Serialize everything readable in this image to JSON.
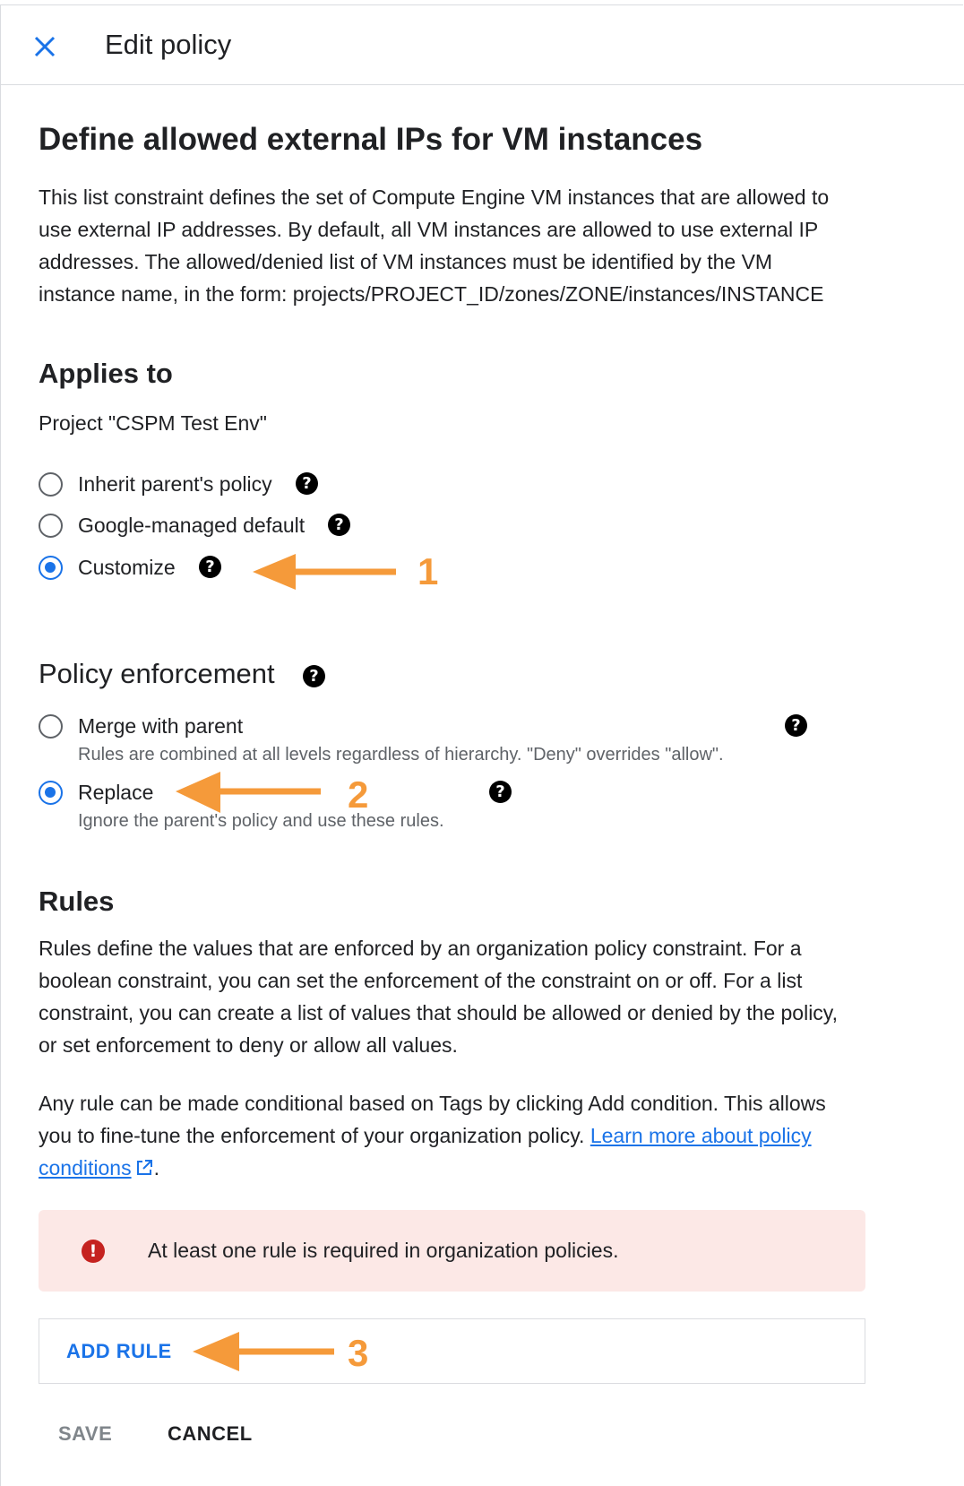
{
  "header": {
    "title": "Edit policy",
    "close_icon": "close-icon"
  },
  "constraint": {
    "title": "Define allowed external IPs for VM instances",
    "description_lines": [
      "This list constraint defines the set of Compute Engine VM instances that are allowed to",
      "use external IP addresses. By default, all VM instances are allowed to use external IP",
      "addresses. The allowed/denied list of VM instances must be identified by the VM",
      "instance name, in the form: projects/PROJECT_ID/zones/ZONE/instances/INSTANCE"
    ]
  },
  "applies_to": {
    "heading": "Applies to",
    "target": "Project \"CSPM Test Env\"",
    "options": [
      {
        "label": "Inherit parent's policy",
        "checked": false
      },
      {
        "label": "Google-managed default",
        "checked": false
      },
      {
        "label": "Customize",
        "checked": true
      }
    ]
  },
  "enforcement": {
    "heading": "Policy enforcement",
    "options": [
      {
        "label": "Merge with parent",
        "sublabel": "Rules are combined at all levels regardless of hierarchy. \"Deny\" overrides \"allow\".",
        "checked": false
      },
      {
        "label": "Replace",
        "sublabel": "Ignore the parent's policy and use these rules.",
        "checked": true
      }
    ]
  },
  "rules": {
    "heading": "Rules",
    "description_lines": [
      "Rules define the values that are enforced by an organization policy constraint. For a",
      "boolean constraint, you can set the enforcement of the constraint on or off. For a list",
      "constraint, you can create a list of values that should be allowed or denied by the policy,",
      "or set enforcement to deny or allow all values."
    ],
    "conditions_line1": "Any rule can be made conditional based on Tags by clicking Add condition. This allows",
    "conditions_line2_prefix": "you to fine-tune the enforcement of your organization policy. ",
    "link_part1": "Learn more about policy",
    "link_part2": "conditions",
    "link_suffix": ".",
    "error": "At least one rule is required in organization policies.",
    "add_rule": "ADD RULE"
  },
  "footer": {
    "save": "SAVE",
    "cancel": "CANCEL"
  },
  "annotations": [
    "1",
    "2",
    "3"
  ],
  "colors": {
    "accent": "#1a73e8",
    "annotation": "#f59a3a",
    "error_bg": "#fce8e6",
    "error_icon": "#c5221f"
  }
}
